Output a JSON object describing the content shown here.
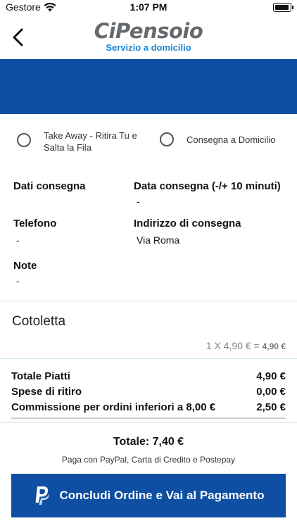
{
  "status_bar": {
    "carrier": "Gestore",
    "time": "1:07 PM"
  },
  "header": {
    "logo_main": "CiPensoio",
    "logo_sub": "Servizio a domicilio"
  },
  "options": {
    "take_away": "Take Away - Ritira Tu e Salta la Fila",
    "delivery": "Consegna a Domicilio"
  },
  "info": {
    "dati_consegna": {
      "title": "Dati consegna",
      "value": ""
    },
    "data_consegna": {
      "title": "Data consegna (-/+ 10 minuti)",
      "value": "-"
    },
    "telefono": {
      "title": "Telefono",
      "value": "-"
    },
    "indirizzo": {
      "title": "Indirizzo di consegna",
      "value": "Via Roma"
    },
    "note": {
      "title": "Note",
      "value": "-"
    }
  },
  "item": {
    "name": "Cotoletta",
    "qty_price": "1 X 4,90 € =",
    "line_total": "4,90 €"
  },
  "totals": [
    {
      "label": "Totale Piatti",
      "value": "4,90 €"
    },
    {
      "label": "Spese di ritiro",
      "value": "0,00 €"
    },
    {
      "label": "Commissione per ordini inferiori a 8,00 €",
      "value": "2,50 €"
    }
  ],
  "grand_total": "Totale: 7,40 €",
  "pay_with": "Paga con PayPal, Carta di Credito e Postepay",
  "cta": {
    "label": "Concludi Ordine e Vai al Pagamento",
    "icon": "paypal-icon"
  },
  "colors": {
    "brand_blue": "#0f4fa3",
    "logo_blue": "#1a86d6",
    "logo_gray": "#666a6e",
    "divider": "#cfe5f3"
  }
}
